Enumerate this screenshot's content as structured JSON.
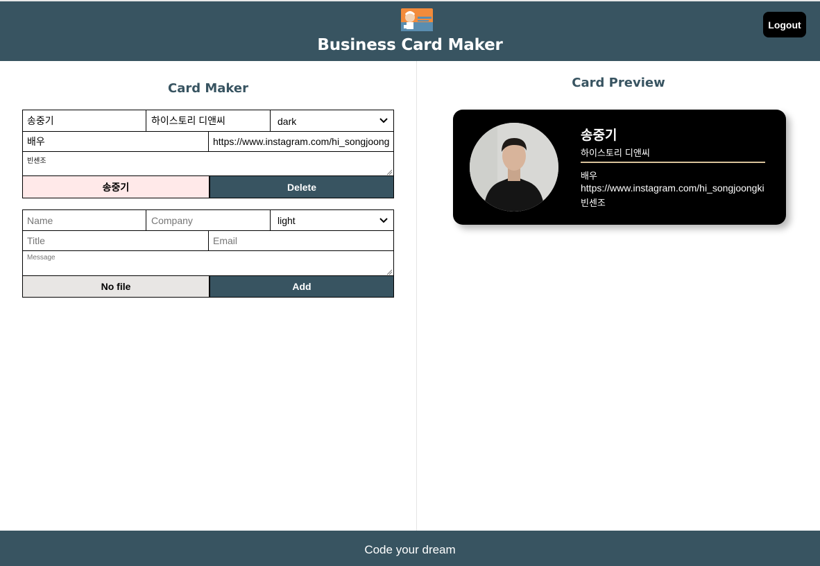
{
  "header": {
    "title": "Business Card Maker",
    "logout_label": "Logout",
    "logo_icon": "business-card-logo-icon"
  },
  "maker": {
    "title": "Card Maker",
    "cards": [
      {
        "name": "송중기",
        "company": "하이스토리 디앤씨",
        "theme": "dark",
        "title": "배우",
        "email": "https://www.instagram.com/hi_songjoongki",
        "message": "빈센조",
        "file_label": "송중기",
        "action_label": "Delete"
      }
    ],
    "new_card": {
      "name_placeholder": "Name",
      "company_placeholder": "Company",
      "theme": "light",
      "title_placeholder": "Title",
      "email_placeholder": "Email",
      "message_placeholder": "Message",
      "file_label": "No file",
      "action_label": "Add"
    }
  },
  "preview": {
    "title": "Card Preview",
    "card": {
      "name": "송중기",
      "company": "하이스토리 디앤씨",
      "title": "배우",
      "email": "https://www.instagram.com/hi_songjoongki",
      "message": "빈센조",
      "theme": "dark"
    }
  },
  "footer": {
    "text": "Code your dream"
  },
  "colors": {
    "brand": "#385461",
    "card_dark": "#000000",
    "card_rule": "#d8c29b",
    "file_loaded_bg": "#ffe9e9",
    "file_empty_bg": "#e8e6e4"
  }
}
